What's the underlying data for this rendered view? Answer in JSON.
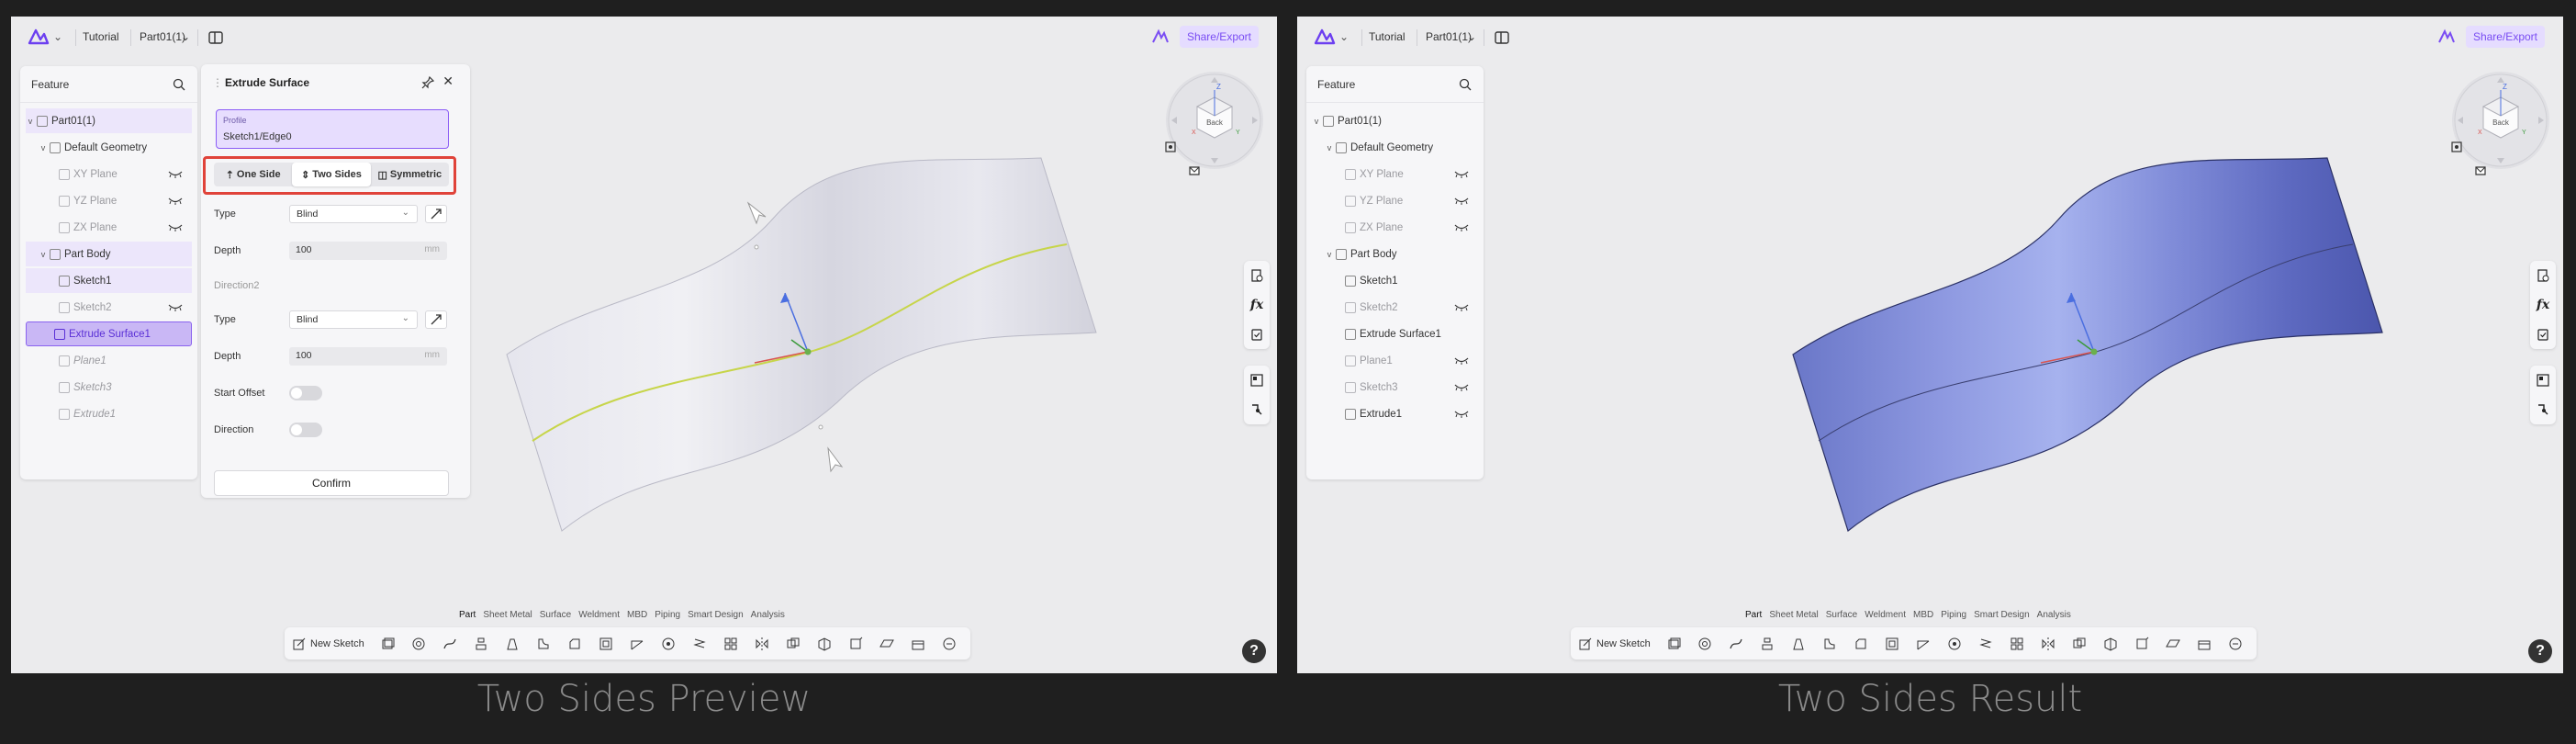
{
  "captions": [
    "Two Sides Preview",
    "Two Sides Result"
  ],
  "topbar": {
    "tutorial": "Tutorial",
    "document": "Part01(1)",
    "share": "Share/Export"
  },
  "tree": {
    "header": "Feature",
    "items": [
      {
        "label": "Part01(1)"
      },
      {
        "label": "Default Geometry"
      },
      {
        "label": "XY Plane"
      },
      {
        "label": "YZ Plane"
      },
      {
        "label": "ZX Plane"
      },
      {
        "label": "Part Body"
      },
      {
        "label": "Sketch1"
      },
      {
        "label": "Sketch2"
      },
      {
        "label": "Extrude Surface1"
      },
      {
        "label": "Plane1"
      },
      {
        "label": "Sketch3"
      },
      {
        "label": "Extrude1"
      }
    ]
  },
  "dialog": {
    "title": "Extrude Surface",
    "profile_label": "Profile",
    "profile_value": "Sketch1/Edge0",
    "segments": [
      "One Side",
      "Two Sides",
      "Symmetric"
    ],
    "active_segment": "Two Sides",
    "type_label": "Type",
    "type_value": "Blind",
    "depth_label": "Depth",
    "depth_value": "100",
    "unit": "mm",
    "direction2": "Direction2",
    "type2_label": "Type",
    "type2_value": "Blind",
    "depth2_label": "Depth",
    "depth2_value": "100",
    "start_offset": "Start Offset",
    "direction": "Direction",
    "confirm": "Confirm"
  },
  "toolbar": {
    "modes": [
      "Part",
      "Sheet Metal",
      "Surface",
      "Weldment",
      "MBD",
      "Piping",
      "Smart Design",
      "Analysis"
    ],
    "active_mode": "Part",
    "new_sketch": "New Sketch",
    "help": "?"
  },
  "navcube": {
    "face_label": "Back",
    "axis_z": "Z",
    "axis_x": "X",
    "axis_y": "Y"
  },
  "colors": {
    "accent": "#8b5cf6",
    "highlight_box": "#e0433a",
    "surface_preview": "#dcdce6",
    "surface_result": "#6b78cc",
    "curve": "#c7d54a"
  }
}
